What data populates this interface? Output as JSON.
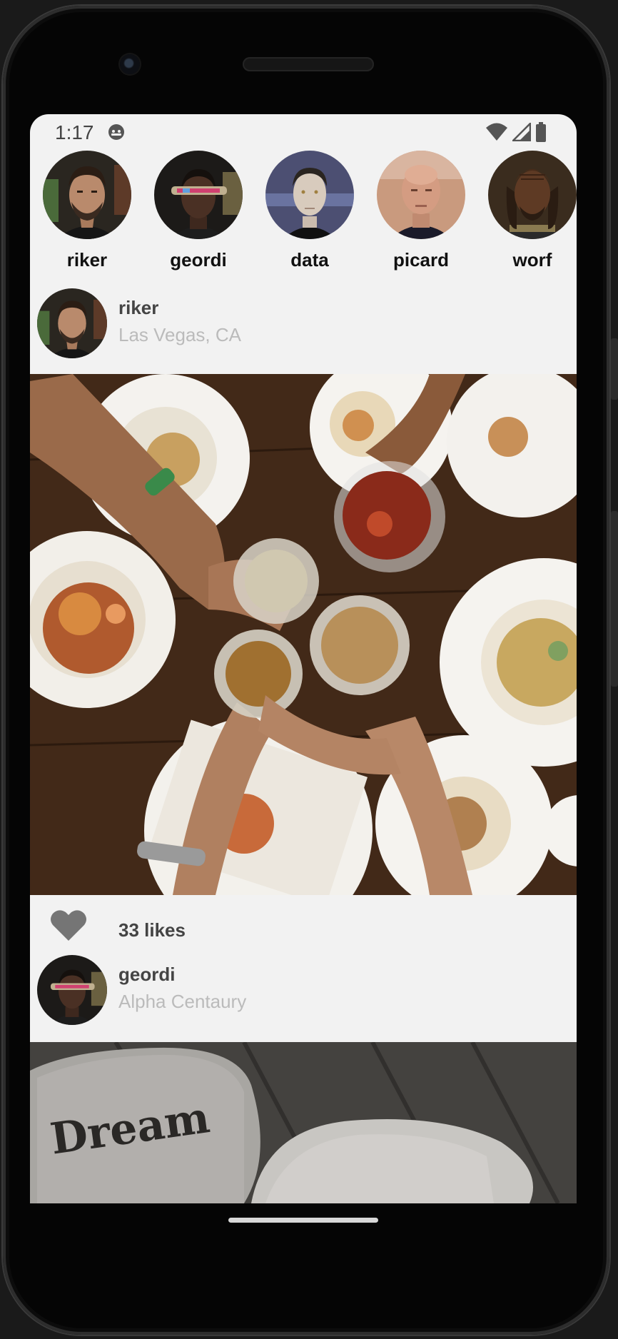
{
  "status_bar": {
    "time": "1:17",
    "app_icon": "android-debug-icon",
    "icons": [
      "wifi-icon",
      "cell-signal-icon",
      "battery-icon"
    ]
  },
  "stories": [
    {
      "name": "riker",
      "colors": {
        "bg": "#2a2620",
        "skin": "#b98a6c",
        "hair": "#2b1d14",
        "uniform": "#1a1a1a"
      }
    },
    {
      "name": "geordi",
      "colors": {
        "bg": "#1c1a18",
        "skin": "#4a3024",
        "hair": "#15100d",
        "uniform": "#1d1d1d"
      }
    },
    {
      "name": "data",
      "colors": {
        "bg": "#4c4f72",
        "skin": "#d8cbbd",
        "hair": "#2a2520",
        "uniform": "#111111"
      }
    },
    {
      "name": "picard",
      "colors": {
        "bg": "#c99a7e",
        "skin": "#d49c82",
        "hair": "#d49c82",
        "uniform": "#1b1b2a"
      }
    },
    {
      "name": "worf",
      "colors": {
        "bg": "#3a2c1e",
        "skin": "#5e3a24",
        "hair": "#2a1c12",
        "uniform": "#2a2a2a"
      }
    }
  ],
  "posts": [
    {
      "user": "riker",
      "location": "Las Vegas, CA",
      "image": "dinner-toast-photo",
      "likes": "33 likes",
      "like_icon": "heart-icon"
    },
    {
      "user": "geordi",
      "location": "Alpha Centaury",
      "image": "dream-stones-photo",
      "stone_text": "Dream"
    }
  ]
}
